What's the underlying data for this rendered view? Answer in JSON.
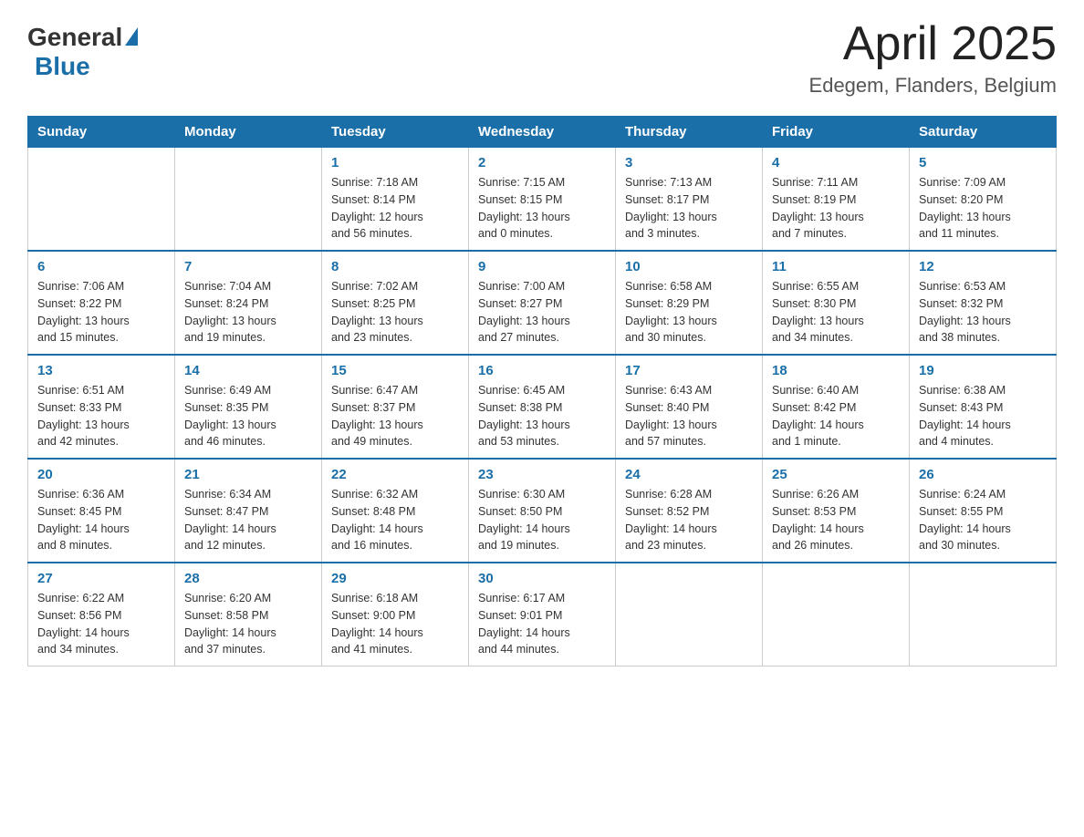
{
  "header": {
    "logo_general": "General",
    "logo_blue": "Blue",
    "month_year": "April 2025",
    "location": "Edegem, Flanders, Belgium"
  },
  "weekdays": [
    "Sunday",
    "Monday",
    "Tuesday",
    "Wednesday",
    "Thursday",
    "Friday",
    "Saturday"
  ],
  "weeks": [
    [
      {
        "day": "",
        "info": ""
      },
      {
        "day": "",
        "info": ""
      },
      {
        "day": "1",
        "info": "Sunrise: 7:18 AM\nSunset: 8:14 PM\nDaylight: 12 hours\nand 56 minutes."
      },
      {
        "day": "2",
        "info": "Sunrise: 7:15 AM\nSunset: 8:15 PM\nDaylight: 13 hours\nand 0 minutes."
      },
      {
        "day": "3",
        "info": "Sunrise: 7:13 AM\nSunset: 8:17 PM\nDaylight: 13 hours\nand 3 minutes."
      },
      {
        "day": "4",
        "info": "Sunrise: 7:11 AM\nSunset: 8:19 PM\nDaylight: 13 hours\nand 7 minutes."
      },
      {
        "day": "5",
        "info": "Sunrise: 7:09 AM\nSunset: 8:20 PM\nDaylight: 13 hours\nand 11 minutes."
      }
    ],
    [
      {
        "day": "6",
        "info": "Sunrise: 7:06 AM\nSunset: 8:22 PM\nDaylight: 13 hours\nand 15 minutes."
      },
      {
        "day": "7",
        "info": "Sunrise: 7:04 AM\nSunset: 8:24 PM\nDaylight: 13 hours\nand 19 minutes."
      },
      {
        "day": "8",
        "info": "Sunrise: 7:02 AM\nSunset: 8:25 PM\nDaylight: 13 hours\nand 23 minutes."
      },
      {
        "day": "9",
        "info": "Sunrise: 7:00 AM\nSunset: 8:27 PM\nDaylight: 13 hours\nand 27 minutes."
      },
      {
        "day": "10",
        "info": "Sunrise: 6:58 AM\nSunset: 8:29 PM\nDaylight: 13 hours\nand 30 minutes."
      },
      {
        "day": "11",
        "info": "Sunrise: 6:55 AM\nSunset: 8:30 PM\nDaylight: 13 hours\nand 34 minutes."
      },
      {
        "day": "12",
        "info": "Sunrise: 6:53 AM\nSunset: 8:32 PM\nDaylight: 13 hours\nand 38 minutes."
      }
    ],
    [
      {
        "day": "13",
        "info": "Sunrise: 6:51 AM\nSunset: 8:33 PM\nDaylight: 13 hours\nand 42 minutes."
      },
      {
        "day": "14",
        "info": "Sunrise: 6:49 AM\nSunset: 8:35 PM\nDaylight: 13 hours\nand 46 minutes."
      },
      {
        "day": "15",
        "info": "Sunrise: 6:47 AM\nSunset: 8:37 PM\nDaylight: 13 hours\nand 49 minutes."
      },
      {
        "day": "16",
        "info": "Sunrise: 6:45 AM\nSunset: 8:38 PM\nDaylight: 13 hours\nand 53 minutes."
      },
      {
        "day": "17",
        "info": "Sunrise: 6:43 AM\nSunset: 8:40 PM\nDaylight: 13 hours\nand 57 minutes."
      },
      {
        "day": "18",
        "info": "Sunrise: 6:40 AM\nSunset: 8:42 PM\nDaylight: 14 hours\nand 1 minute."
      },
      {
        "day": "19",
        "info": "Sunrise: 6:38 AM\nSunset: 8:43 PM\nDaylight: 14 hours\nand 4 minutes."
      }
    ],
    [
      {
        "day": "20",
        "info": "Sunrise: 6:36 AM\nSunset: 8:45 PM\nDaylight: 14 hours\nand 8 minutes."
      },
      {
        "day": "21",
        "info": "Sunrise: 6:34 AM\nSunset: 8:47 PM\nDaylight: 14 hours\nand 12 minutes."
      },
      {
        "day": "22",
        "info": "Sunrise: 6:32 AM\nSunset: 8:48 PM\nDaylight: 14 hours\nand 16 minutes."
      },
      {
        "day": "23",
        "info": "Sunrise: 6:30 AM\nSunset: 8:50 PM\nDaylight: 14 hours\nand 19 minutes."
      },
      {
        "day": "24",
        "info": "Sunrise: 6:28 AM\nSunset: 8:52 PM\nDaylight: 14 hours\nand 23 minutes."
      },
      {
        "day": "25",
        "info": "Sunrise: 6:26 AM\nSunset: 8:53 PM\nDaylight: 14 hours\nand 26 minutes."
      },
      {
        "day": "26",
        "info": "Sunrise: 6:24 AM\nSunset: 8:55 PM\nDaylight: 14 hours\nand 30 minutes."
      }
    ],
    [
      {
        "day": "27",
        "info": "Sunrise: 6:22 AM\nSunset: 8:56 PM\nDaylight: 14 hours\nand 34 minutes."
      },
      {
        "day": "28",
        "info": "Sunrise: 6:20 AM\nSunset: 8:58 PM\nDaylight: 14 hours\nand 37 minutes."
      },
      {
        "day": "29",
        "info": "Sunrise: 6:18 AM\nSunset: 9:00 PM\nDaylight: 14 hours\nand 41 minutes."
      },
      {
        "day": "30",
        "info": "Sunrise: 6:17 AM\nSunset: 9:01 PM\nDaylight: 14 hours\nand 44 minutes."
      },
      {
        "day": "",
        "info": ""
      },
      {
        "day": "",
        "info": ""
      },
      {
        "day": "",
        "info": ""
      }
    ]
  ]
}
